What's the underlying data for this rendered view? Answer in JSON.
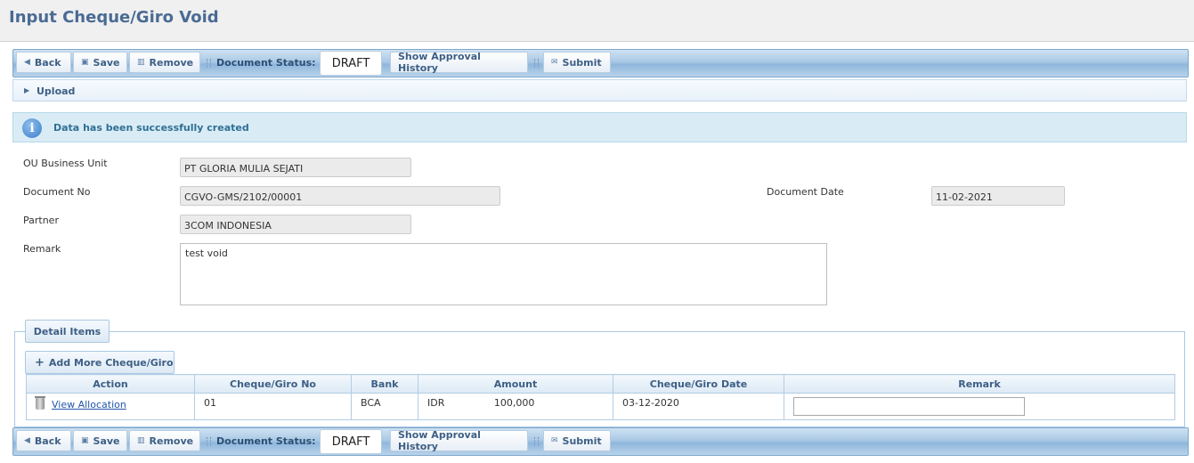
{
  "page": {
    "title": "Input Cheque/Giro Void"
  },
  "toolbar": {
    "back_label": "Back",
    "save_label": "Save",
    "remove_label": "Remove",
    "status_label": "Document Status:",
    "status_value": "DRAFT",
    "history_label": "Show Approval History",
    "submit_label": "Submit"
  },
  "upload": {
    "label": "Upload"
  },
  "info": {
    "message": "Data has been successfully created"
  },
  "form": {
    "ou_label": "OU Business Unit",
    "ou_value": "PT GLORIA MULIA SEJATI",
    "docno_label": "Document No",
    "docno_value": "CGVO-GMS/2102/00001",
    "docdate_label": "Document Date",
    "docdate_value": "11-02-2021",
    "partner_label": "Partner",
    "partner_value": "3COM INDONESIA",
    "remark_label": "Remark",
    "remark_value": "test void"
  },
  "detail": {
    "legend": "Detail Items",
    "add_label": "Add More Cheque/Giro",
    "columns": [
      "Action",
      "Cheque/Giro No",
      "Bank",
      "Amount",
      "Cheque/Giro Date",
      "Remark"
    ],
    "rows": [
      {
        "action_link": "View Allocation",
        "cheque_no": "01",
        "bank": "BCA",
        "currency": "IDR",
        "amount": "100,000",
        "date": "03-12-2020",
        "remark": ""
      }
    ]
  },
  "icons": {
    "back": "caret-left-icon",
    "save": "floppy-icon",
    "remove": "trash-icon",
    "submit": "envelope-icon",
    "upload": "caret-right-icon",
    "info": "info-icon",
    "add": "plus-icon",
    "row_delete": "trash-can-icon"
  }
}
